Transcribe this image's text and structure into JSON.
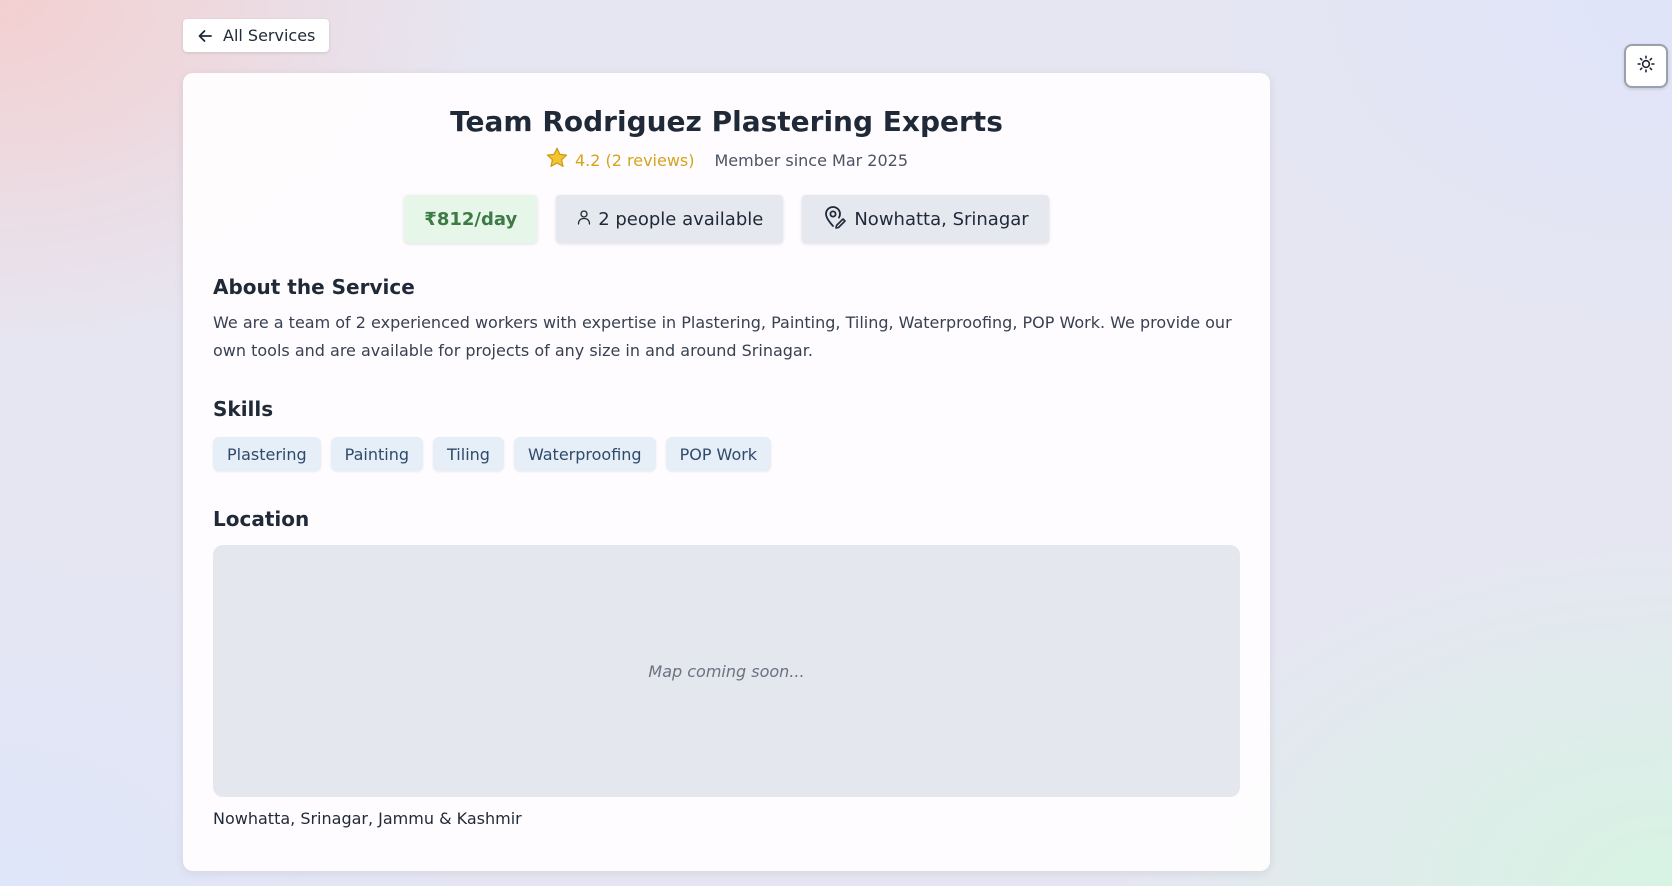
{
  "nav": {
    "back_label": "All Services"
  },
  "service": {
    "title": "Team Rodriguez Plastering Experts",
    "rating_text": "4.2 (2 reviews)",
    "member_since": "Member since Mar 2025",
    "price": "₹812/day",
    "availability": "2 people available",
    "location_short": "Nowhatta, Srinagar"
  },
  "about": {
    "heading": "About the Service",
    "text": "We are a team of 2 experienced workers with expertise in Plastering, Painting, Tiling, Waterproofing, POP Work. We provide our own tools and are available for projects of any size in and around Srinagar."
  },
  "skills": {
    "heading": "Skills",
    "items": [
      "Plastering",
      "Painting",
      "Tiling",
      "Waterproofing",
      "POP Work"
    ]
  },
  "location": {
    "heading": "Location",
    "map_placeholder": "Map coming soon...",
    "full_address": "Nowhatta, Srinagar, Jammu & Kashmir"
  },
  "icons": {
    "back": "arrow-left-icon",
    "theme": "sun-icon",
    "rating": "star-icon",
    "people": "person-icon",
    "location": "map-pin-icon"
  },
  "colors": {
    "price_bg": "#e6f6e8",
    "price_text": "#3d7a45",
    "rating": "#d4a41c",
    "skill_bg": "#e6eef8"
  }
}
